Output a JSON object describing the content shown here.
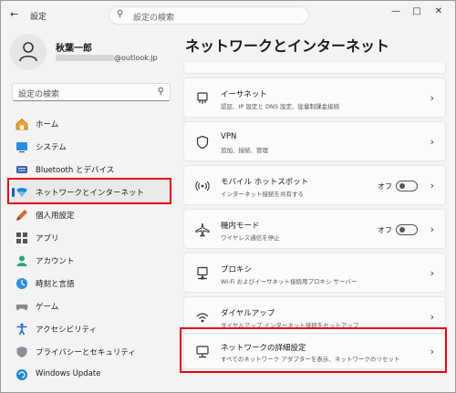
{
  "window": {
    "title": "設定"
  },
  "search": {
    "placeholder": "設定の検索"
  },
  "profile": {
    "name": "秋葉一郎",
    "email_suffix": "@outlook.jp"
  },
  "sidebar": {
    "search_placeholder": "設定の検索",
    "items": [
      {
        "label": "ホーム",
        "icon": "home-icon"
      },
      {
        "label": "システム",
        "icon": "monitor-icon"
      },
      {
        "label": "Bluetooth とデバイス",
        "icon": "bluetooth-icon"
      },
      {
        "label": "ネットワークとインターネット",
        "icon": "wifi-icon",
        "active": true
      },
      {
        "label": "個人用設定",
        "icon": "brush-icon"
      },
      {
        "label": "アプリ",
        "icon": "apps-icon"
      },
      {
        "label": "アカウント",
        "icon": "account-icon"
      },
      {
        "label": "時刻と言語",
        "icon": "globe-clock-icon"
      },
      {
        "label": "ゲーム",
        "icon": "gamepad-icon"
      },
      {
        "label": "アクセシビリティ",
        "icon": "accessibility-icon"
      },
      {
        "label": "プライバシーとセキュリティ",
        "icon": "shield-icon"
      },
      {
        "label": "Windows Update",
        "icon": "update-icon"
      }
    ]
  },
  "main": {
    "title": "ネットワークとインターネット",
    "cards": [
      {
        "title": "イーサネット",
        "subtitle": "認証、IP 設定と DNS 設定、従量制課金接続",
        "icon": "ethernet-icon"
      },
      {
        "title": "VPN",
        "subtitle": "追加、接続、管理",
        "icon": "vpn-shield-icon"
      },
      {
        "title": "モバイル ホットスポット",
        "subtitle": "インターネット接続を共有する",
        "icon": "hotspot-icon",
        "toggle_label": "オフ"
      },
      {
        "title": "機内モード",
        "subtitle": "ワイヤレス通信を停止",
        "icon": "airplane-icon",
        "toggle_label": "オフ"
      },
      {
        "title": "プロキシ",
        "subtitle": "Wi-Fi およびイーサネット接続用プロキシ サーバー",
        "icon": "proxy-icon"
      },
      {
        "title": "ダイヤルアップ",
        "subtitle": "ダイヤルアップ インターネット接続をセットアップ",
        "icon": "dialup-icon"
      },
      {
        "title": "ネットワークの詳細設定",
        "subtitle": "すべてのネットワーク アダプターを表示、ネットワークのリセット",
        "icon": "network-adapter-icon"
      }
    ]
  },
  "colors": {
    "accent": "#005fb8",
    "highlight": "#e60012"
  }
}
